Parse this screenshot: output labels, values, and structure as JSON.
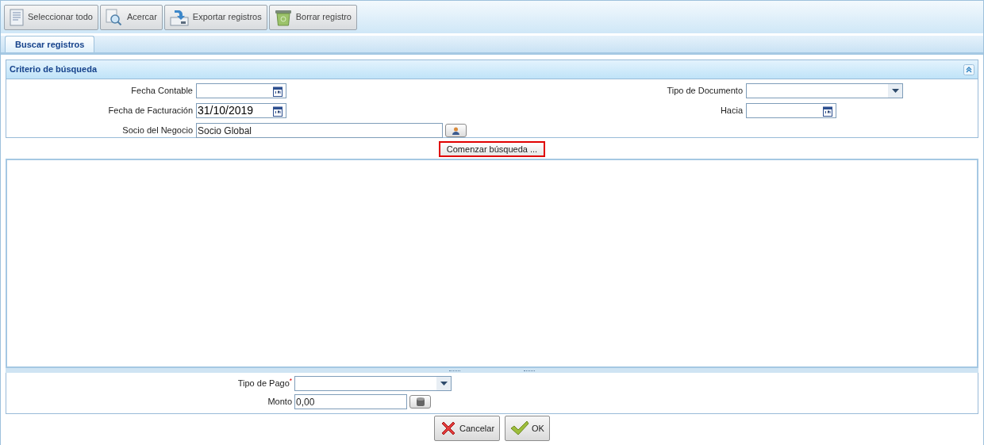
{
  "toolbar": [
    {
      "label": "Seleccionar todo",
      "kind": "list"
    },
    {
      "label": "Acercar",
      "kind": "zoom"
    },
    {
      "label": "Exportar registros",
      "kind": "export"
    },
    {
      "label": "Borrar registro",
      "kind": "trash"
    }
  ],
  "tabs": [
    {
      "label": "Buscar registros",
      "selected": true
    }
  ],
  "criteria": {
    "title": "Criterio de búsqueda",
    "left": [
      {
        "label": "Fecha Contable",
        "kind": "date"
      },
      {
        "label": "Fecha de Facturación",
        "kind": "date",
        "value": "31/10/2019"
      },
      {
        "label": "Socio del Negocio",
        "kind": "lookup",
        "value": "Socio Global"
      }
    ],
    "right": [
      {
        "label": "Tipo de Documento",
        "kind": "select"
      },
      {
        "label": "Hacia",
        "kind": "date"
      }
    ]
  },
  "search_button": "Comenzar búsqueda ...",
  "bottom_fields": [
    {
      "label": "Tipo de Pago",
      "required_mark": "*",
      "kind": "select"
    },
    {
      "label": "Monto",
      "kind": "number",
      "value": "0,00"
    }
  ],
  "actions": [
    {
      "label": "Cancelar",
      "kind": "cancel"
    },
    {
      "label": "OK",
      "kind": "ok"
    }
  ]
}
